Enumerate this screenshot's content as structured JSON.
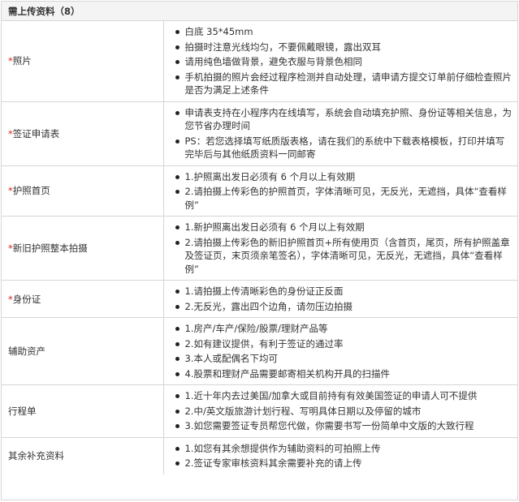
{
  "header": {
    "title": "需上传资料（8）"
  },
  "rows": [
    {
      "required": true,
      "label": "照片",
      "items": [
        "白底  35*45mm",
        "拍摄时注意光线均匀，不要佩戴眼镜，露出双耳",
        "请用纯色墙做背景，避免衣服与背景色相同",
        "手机拍摄的照片会经过程序检测并自动处理，请申请方提交订单前仔细检查照片是否为满足上述条件"
      ]
    },
    {
      "required": true,
      "label": "签证申请表",
      "items": [
        "申请表支持在小程序内在线填写，系统会自动填充护照、身份证等相关信息，为您节省办理时间",
        "PS：若您选择填写纸质版表格，请在我们的系统中下载表格模板，打印并填写完毕后与其他纸质资料一同邮寄"
      ]
    },
    {
      "required": true,
      "label": "护照首页",
      "items": [
        "1.护照离出发日必须有 6 个月以上有效期",
        "2.请拍摄上传彩色的护照首页，字体清晰可见，无反光，无遮挡，具体“查看样例”"
      ]
    },
    {
      "required": true,
      "label": "新旧护照整本拍摄",
      "items": [
        "1.新护照离出发日必须有 6 个月以上有效期",
        "2.请拍摄上传彩色的新旧护照首页+所有使用页（含首页，尾页，所有护照盖章及签证页，末页须亲笔签名），字体清晰可见，无反光，无遮挡，具体“查看样例”"
      ]
    },
    {
      "required": true,
      "label": "身份证",
      "items": [
        "1.请拍摄上传清晰彩色的身份证正反面",
        "2.无反光，露出四个边角，请勿压边拍摄"
      ]
    },
    {
      "required": false,
      "label": "辅助资产",
      "items": [
        "1.房产/车产/保险/股票/理财产品等",
        "2.如有建议提供，有利于签证的通过率",
        "3.本人或配偶名下均可",
        "4.股票和理财产品需要邮寄相关机构开具的扫描件"
      ]
    },
    {
      "required": false,
      "label": "行程单",
      "items": [
        "1.近十年内去过美国/加拿大或目前持有有效美国签证的申请人可不提供",
        "2.中/英文版旅游计划行程、写明具体日期以及停留的城市",
        "3.如您需要签证专员帮您代做，你需要书写一份简单中文版的大致行程"
      ]
    },
    {
      "required": false,
      "label": "其余补充资料",
      "items": [
        "1.如您有其余想提供作为辅助资料的可拍照上传",
        "2.签证专家审核资料其余需要补充的请上传"
      ]
    }
  ],
  "required_mark": "*"
}
